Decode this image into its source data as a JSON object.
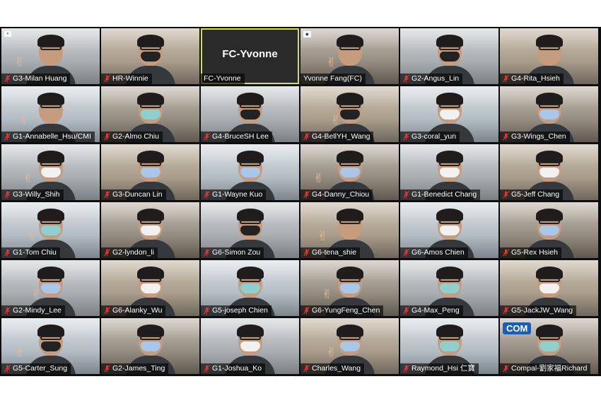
{
  "meeting": {
    "participants": [
      {
        "name": "G3-Milan Huang",
        "muted": true,
        "mask": "none",
        "logo": "company-logo"
      },
      {
        "name": "HR-Winnie",
        "muted": true,
        "mask": "black"
      },
      {
        "name": "FC-Yvonne",
        "muted": false,
        "video_off": true,
        "title": "FC-Yvonne",
        "active_speaker": true
      },
      {
        "name": "Yvonne Fang(FC)",
        "muted": false,
        "mask": "none",
        "logo": "franklin-covey-logo"
      },
      {
        "name": "G2-Angus_Lin",
        "muted": true,
        "mask": "black"
      },
      {
        "name": "G4-Rita_Hsieh",
        "muted": true,
        "mask": "none"
      },
      {
        "name": "G1-Annabelle_Hsu/CMI",
        "muted": true,
        "mask": "none"
      },
      {
        "name": "G2-Almo Chiu",
        "muted": true,
        "mask": "teal"
      },
      {
        "name": "G4-BruceSH Lee",
        "muted": true,
        "mask": "black"
      },
      {
        "name": "G4-BellYH_Wang",
        "muted": true,
        "mask": "black"
      },
      {
        "name": "G3-coral_yun",
        "muted": true,
        "mask": "white"
      },
      {
        "name": "G3-Wings_Chen",
        "muted": true,
        "mask": "blue"
      },
      {
        "name": "G3-Willy_Shih",
        "muted": true,
        "mask": "white"
      },
      {
        "name": "G3-Duncan Lin",
        "muted": true,
        "mask": "blue"
      },
      {
        "name": "G1-Wayne Kuo",
        "muted": true,
        "mask": "blue"
      },
      {
        "name": "G4-Danny_Chiou",
        "muted": true,
        "mask": "blue"
      },
      {
        "name": "G1-Benedict Chang",
        "muted": true,
        "mask": "white"
      },
      {
        "name": "G5-Jeff Chang",
        "muted": true,
        "mask": "white"
      },
      {
        "name": "G1-Tom Chiu",
        "muted": true,
        "mask": "teal"
      },
      {
        "name": "G2-lyndon_li",
        "muted": true,
        "mask": "white"
      },
      {
        "name": "G6-Simon Zou",
        "muted": true,
        "mask": "black"
      },
      {
        "name": "G6-tena_shie",
        "muted": true,
        "mask": "none"
      },
      {
        "name": "G6-Amos Chien",
        "muted": true,
        "mask": "white"
      },
      {
        "name": "G5-Rex Hsieh",
        "muted": true,
        "mask": "blue"
      },
      {
        "name": "G2-Mindy_Lee",
        "muted": true,
        "mask": "blue"
      },
      {
        "name": "G6-Alanky_Wu",
        "muted": true,
        "mask": "white"
      },
      {
        "name": "G5-joseph Chien",
        "muted": true,
        "mask": "teal"
      },
      {
        "name": "G6-YungFeng_Chen",
        "muted": true,
        "mask": "blue"
      },
      {
        "name": "G4-Max_Peng",
        "muted": true,
        "mask": "teal"
      },
      {
        "name": "G5-JackJW_Wang",
        "muted": true,
        "mask": "white"
      },
      {
        "name": "G5-Carter_Sung",
        "muted": true,
        "mask": "black"
      },
      {
        "name": "G2-James_Ting",
        "muted": true,
        "mask": "blue"
      },
      {
        "name": "G1-Joshua_Ko",
        "muted": true,
        "mask": "white"
      },
      {
        "name": "Charles_Wang",
        "muted": true,
        "mask": "blue"
      },
      {
        "name": "Raymond_Hsi 仁寶",
        "muted": true,
        "mask": "teal"
      },
      {
        "name": "Compal-劉家福Richard",
        "muted": true,
        "mask": "teal",
        "logo": "compal-logo",
        "logo_text": "COM"
      }
    ]
  },
  "colors": {
    "muted_icon": "#e5312f",
    "active_speaker_border": "#d6e23b",
    "gallery_background": "#0e0e0e"
  }
}
